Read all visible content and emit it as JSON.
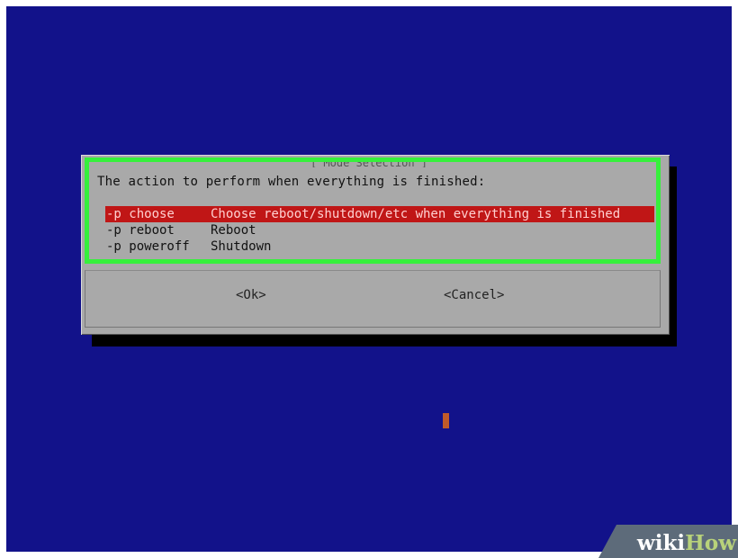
{
  "dialog": {
    "title": "[ Mode Selection ]",
    "prompt": "The action to perform when everything is finished:",
    "items": [
      {
        "tag": "-p choose",
        "description": "Choose reboot/shutdown/etc when everything is finished",
        "selected": true
      },
      {
        "tag": "-p reboot",
        "description": "Reboot",
        "selected": false
      },
      {
        "tag": "-p poweroff",
        "description": "Shutdown",
        "selected": false
      }
    ],
    "ok_label": "<Ok>",
    "cancel_label": "<Cancel>"
  },
  "watermark": {
    "wiki": "wiki",
    "how": "How"
  },
  "colors": {
    "screen_bg": "#12128a",
    "dialog_bg": "#a9a9a9",
    "highlight_frame": "#36f03c",
    "selection": "#c01616"
  }
}
